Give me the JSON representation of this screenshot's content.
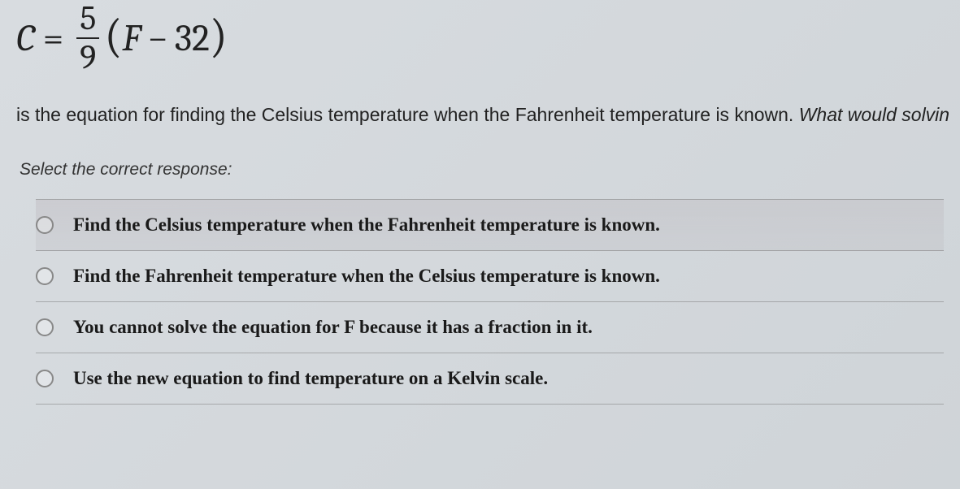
{
  "equation": {
    "lhs_var": "C",
    "equals": "=",
    "frac_num": "5",
    "frac_den": "9",
    "lparen": "(",
    "inner_var": "F",
    "minus": "−",
    "inner_num": "32",
    "rparen": ")"
  },
  "description_part1": "is the equation for finding the Celsius temperature when the Fahrenheit temperature is known.  ",
  "description_part2": "What would solvin",
  "select_prompt": "Select the correct response:",
  "options": [
    {
      "label": "Find the Celsius temperature when the Fahrenheit temperature is known."
    },
    {
      "label": "Find the Fahrenheit temperature when the Celsius temperature is known."
    },
    {
      "label": "You cannot solve the equation for F because it has a fraction in it."
    },
    {
      "label": "Use the new equation to find temperature on a Kelvin scale."
    }
  ]
}
